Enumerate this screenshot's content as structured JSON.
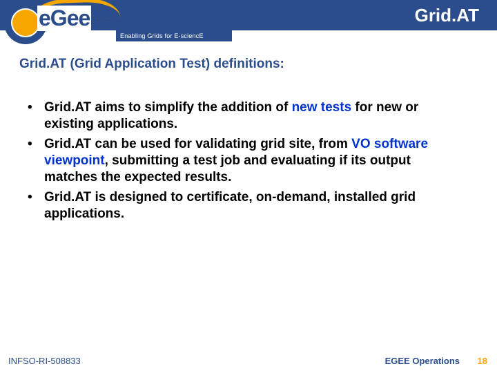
{
  "header": {
    "title": "Grid.AT",
    "tagline": "Enabling Grids for E-sciencE",
    "logo_word": "eGee"
  },
  "subtitle": "Grid.AT (Grid Application Test) definitions:",
  "bullets": [
    {
      "pre": "Grid.AT aims to simplify the addition of ",
      "link": "new tests",
      "post": " for new or existing applications."
    },
    {
      "pre": "Grid.AT can be used for validating grid site, from ",
      "link": "VO software viewpoint",
      "post": ", submitting a test job and evaluating if its output matches the expected results."
    },
    {
      "pre": "Grid.AT is designed to certificate, on-demand, installed grid applications.",
      "link": "",
      "post": ""
    }
  ],
  "footer": {
    "left": "INFSO-RI-508833",
    "right": "EGEE Operations",
    "page": "18"
  },
  "colors": {
    "brand_blue": "#2c4d8c",
    "brand_orange": "#f7a600",
    "link_blue": "#0033cc"
  }
}
